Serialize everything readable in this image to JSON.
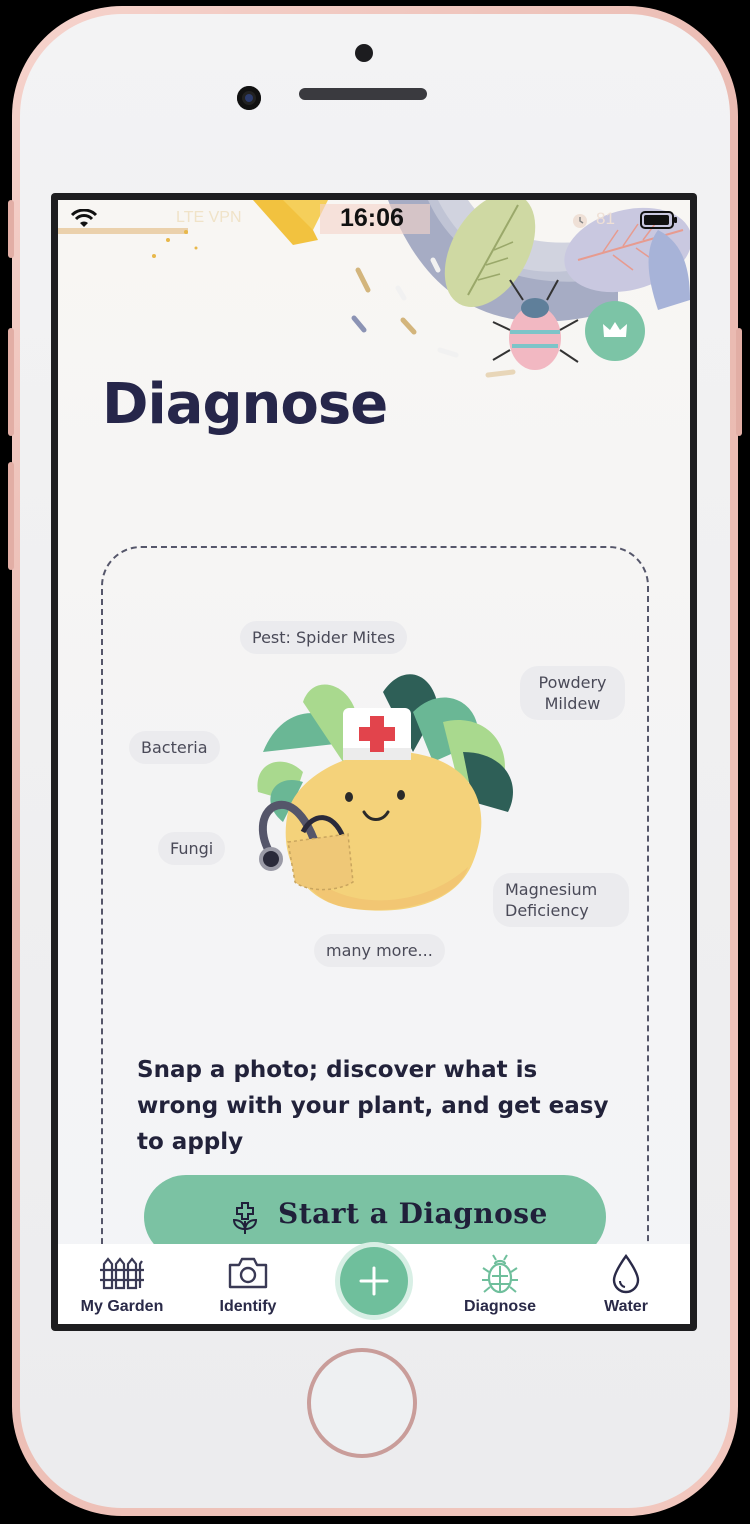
{
  "status_bar": {
    "time": "16:06",
    "carrier": "LTE VPN",
    "battery": "81"
  },
  "header": {
    "title": "Diagnose",
    "premium_icon": "crown-icon"
  },
  "diagnose_card": {
    "tags": [
      "Pest: Spider Mites",
      "Powdery Mildew",
      "Bacteria",
      "Fungi",
      "Magnesium Deficiency",
      "many more..."
    ],
    "description": "Snap a photo; discover what is wrong with your plant, and get easy to apply",
    "cta_label": "Start a Diagnose",
    "cta_icon": "plant-medical-icon"
  },
  "tab_bar": {
    "items": [
      {
        "label": "My Garden",
        "icon": "fence-icon"
      },
      {
        "label": "Identify",
        "icon": "camera-icon"
      },
      {
        "label": "",
        "icon": "plus-icon"
      },
      {
        "label": "Diagnose",
        "icon": "bug-icon",
        "active": true
      },
      {
        "label": "Water",
        "icon": "water-drop-icon"
      }
    ]
  },
  "colors": {
    "accent": "#7bc2a3",
    "title": "#26264a",
    "active_tab_icon": "#6fbf9c"
  }
}
